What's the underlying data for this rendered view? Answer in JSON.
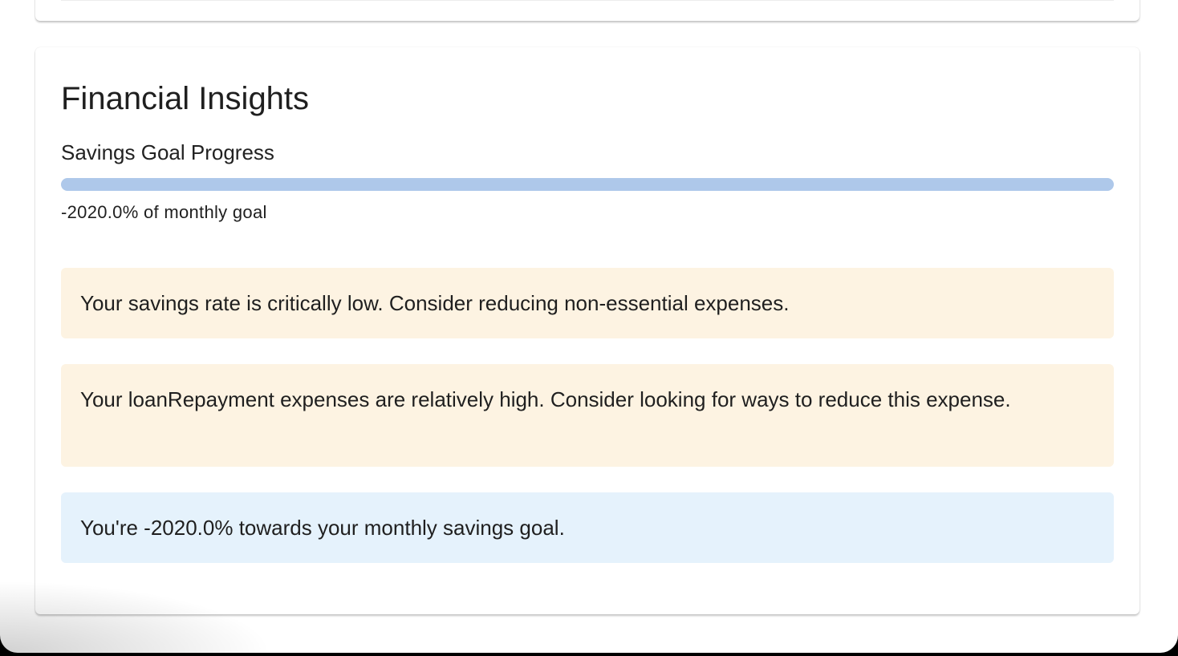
{
  "insights": {
    "title": "Financial Insights",
    "savings_goal": {
      "label": "Savings Goal Progress",
      "percent": -2020.0,
      "caption": "-2020.0% of monthly goal"
    },
    "alerts": [
      {
        "severity": "warning",
        "text": "Your savings rate is critically low. Consider reducing non-essential expenses."
      },
      {
        "severity": "warning",
        "text": "Your loanRepayment expenses are relatively high. Consider looking for ways to reduce this expense."
      },
      {
        "severity": "info",
        "text": "You're -2020.0% towards your monthly savings goal."
      }
    ]
  },
  "colors": {
    "progress_track": "#aec8ea",
    "progress_fill": "#1976d2",
    "warning_bg": "#fdf3e2",
    "info_bg": "#e5f2fc"
  }
}
